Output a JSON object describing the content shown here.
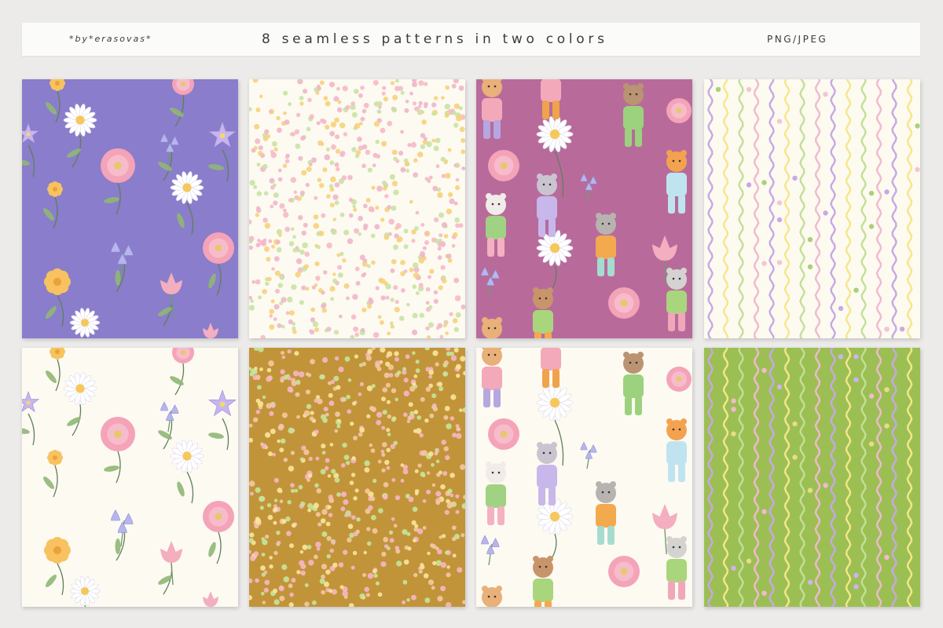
{
  "header": {
    "brand": "*by*erasovas*",
    "title": "8 seamless patterns in two colors",
    "formats": "PNG/JPEG"
  },
  "patterns": [
    {
      "id": "floral-purple",
      "kind": "floral",
      "background": "#8a7dcb"
    },
    {
      "id": "confetti-cream",
      "kind": "confetti",
      "background": "#fdfaf1"
    },
    {
      "id": "animals-magenta",
      "kind": "animals",
      "background": "#b86b9b"
    },
    {
      "id": "waves-cream",
      "kind": "waves",
      "background": "#fdfaf0"
    },
    {
      "id": "floral-cream",
      "kind": "floral",
      "background": "#fdfaf2"
    },
    {
      "id": "confetti-mustard",
      "kind": "confetti",
      "background": "#c2943a"
    },
    {
      "id": "animals-cream",
      "kind": "animals",
      "background": "#fdfaf1"
    },
    {
      "id": "waves-green",
      "kind": "waves",
      "background": "#9cbf54"
    }
  ],
  "palette": {
    "pink": "#f2a5b8",
    "yellow": "#f4c95d",
    "green": "#b6d98a",
    "lilac": "#c3a7e0",
    "leaf": "#6f9c6b",
    "blue": "#b7b5ee"
  }
}
